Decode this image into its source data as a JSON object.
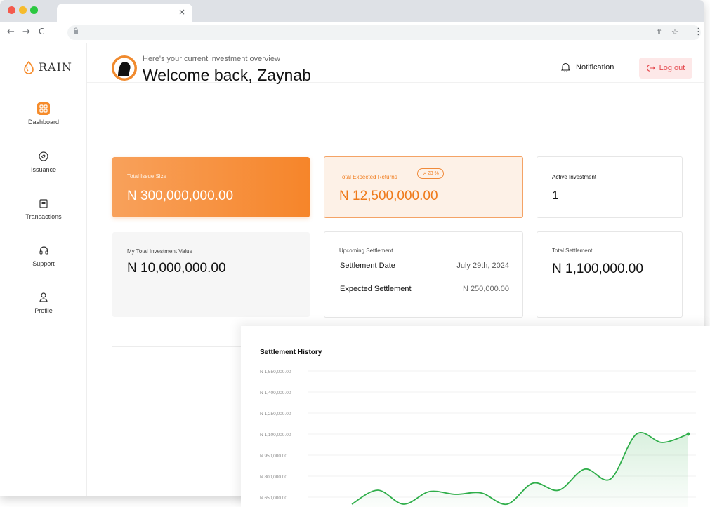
{
  "browser": {
    "tab_close": "×",
    "nav_back": "←",
    "nav_forward": "→",
    "nav_reload": "C",
    "share_icon": "⇧",
    "star_icon": "☆",
    "menu_icon": "⋮"
  },
  "brand": {
    "name": "RAIN",
    "accent": "#f68b2a"
  },
  "sidebar": {
    "items": [
      {
        "label": "Dashboard",
        "icon": "grid-icon",
        "active": true
      },
      {
        "label": "Issuance",
        "icon": "tag-icon",
        "active": false
      },
      {
        "label": "Transactions",
        "icon": "document-icon",
        "active": false
      },
      {
        "label": "Support",
        "icon": "headphones-icon",
        "active": false
      },
      {
        "label": "Profile",
        "icon": "user-icon",
        "active": false
      }
    ]
  },
  "topbar": {
    "notification_label": "Notification",
    "logout_label": "Log out"
  },
  "header": {
    "subtitle": "Here's your current investment overview",
    "welcome": "Welcome back, Zaynab"
  },
  "cards": {
    "total_issue": {
      "label": "Total Issue Size",
      "value": "N 300,000,000.00"
    },
    "expected_returns": {
      "label": "Total Expected Returns",
      "badge": "23 %",
      "value": "N 12,500,000.00"
    },
    "active_investment": {
      "label": "Active Investment",
      "value": "1"
    },
    "total_investment_value": {
      "label": "My Total Investment Value",
      "value": "N 10,000,000.00"
    },
    "upcoming_settlement": {
      "label": "Upcoming Settlement",
      "date_label": "Settlement Date",
      "date_value": "July 29th, 2024",
      "expected_label": "Expected Settlement",
      "expected_value": "N 250,000.00"
    },
    "total_settlement": {
      "label": "Total Settlement",
      "value": "N 1,100,000.00"
    }
  },
  "chart_data": {
    "type": "area",
    "title": "Settlement History",
    "xlabel": "",
    "ylabel": "",
    "y_tick_labels": [
      "N 1,550,000.00",
      "N 1,400,000.00",
      "N 1,250,000.00",
      "N 1,100,000.00",
      "N 950,000.00",
      "N 800,000.00",
      "N 650,000.00"
    ],
    "ylim": [
      650000,
      1550000
    ],
    "grid": true,
    "color": "#2fae4a",
    "series": [
      {
        "values": [
          600000,
          700000,
          600000,
          690000,
          670000,
          680000,
          600000,
          750000,
          700000,
          850000,
          780000,
          1100000,
          1040000,
          1100000
        ]
      }
    ]
  }
}
